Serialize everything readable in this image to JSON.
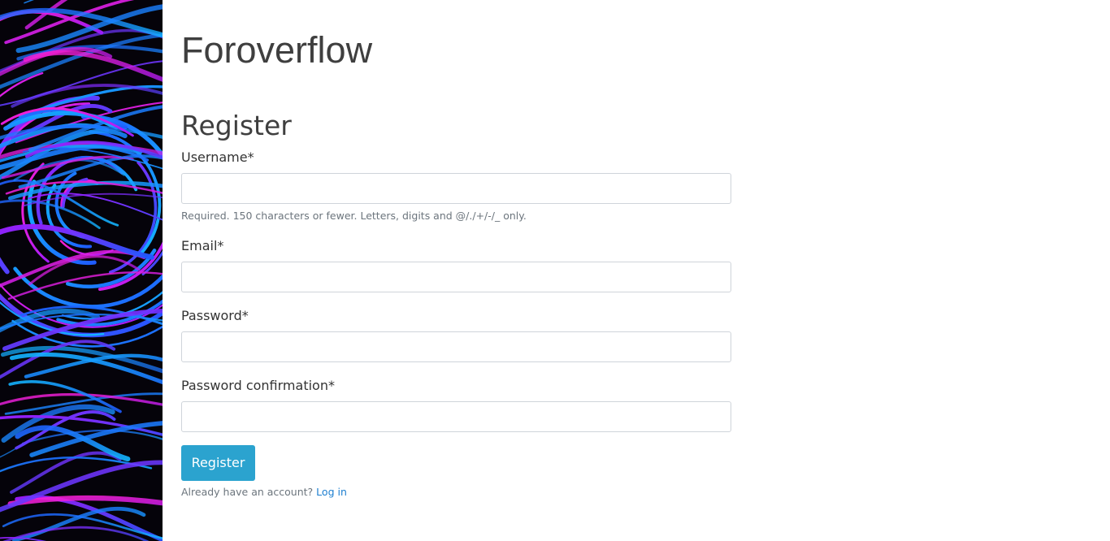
{
  "site": {
    "title": "Foroverflow"
  },
  "form": {
    "title": "Register",
    "fields": [
      {
        "label": "Username*",
        "value": "",
        "placeholder": "",
        "help": "Required. 150 characters or fewer. Letters, digits and @/./+/-/_ only."
      },
      {
        "label": "Email*",
        "value": "",
        "placeholder": ""
      },
      {
        "label": "Password*",
        "value": "",
        "placeholder": ""
      },
      {
        "label": "Password confirmation*",
        "value": "",
        "placeholder": ""
      }
    ],
    "submit_label": "Register",
    "login_prompt": "Already have an account?",
    "login_link": "Log in"
  },
  "theme": {
    "button_color": "#2ba3cf",
    "link_color": "#1d7fd0",
    "art_colors": [
      "#ff1fd0",
      "#a01cff",
      "#1f5bff",
      "#13b7ff",
      "#05030a"
    ]
  }
}
